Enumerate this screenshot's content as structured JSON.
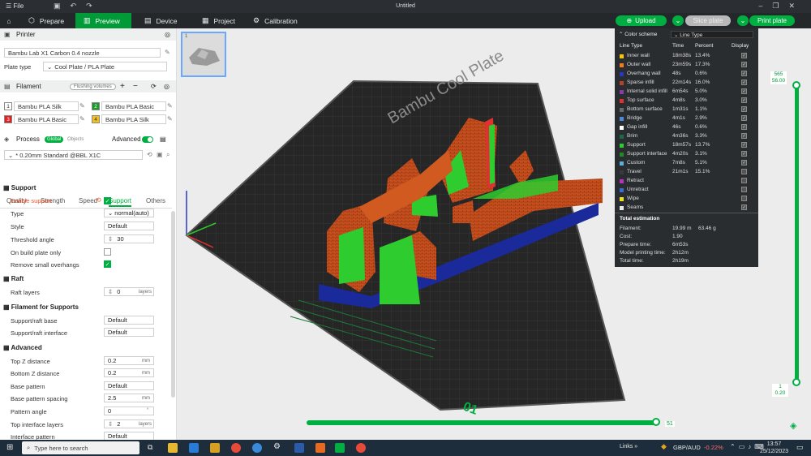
{
  "titlebar": {
    "file": "File",
    "title": "Untitled"
  },
  "nav": {
    "prepare": "Prepare",
    "preview": "Preview",
    "device": "Device",
    "project": "Project",
    "calibration": "Calibration",
    "upload": "Upload",
    "slice": "Slice plate",
    "print": "Print plate"
  },
  "printer": {
    "section": "Printer",
    "name": "Bambu Lab X1 Carbon 0.4 nozzle",
    "plate_label": "Plate type",
    "plate_value": "Cool Plate / PLA Plate"
  },
  "filament": {
    "section": "Filament",
    "flushing": "Flushing volumes",
    "items": [
      {
        "num": "1",
        "name": "Bambu PLA Silk",
        "color": "#ffffff"
      },
      {
        "num": "2",
        "name": "Bambu PLA Basic",
        "color": "#1a9a2a"
      },
      {
        "num": "3",
        "name": "Bambu PLA Basic",
        "color": "#e02020"
      },
      {
        "num": "4",
        "name": "Bambu PLA Silk",
        "color": "#f0c020"
      }
    ]
  },
  "process": {
    "section": "Process",
    "global": "Global",
    "objects": "Objects",
    "advanced": "Advanced",
    "preset": "* 0.20mm Standard @BBL X1C",
    "tabs": [
      "Quality",
      "Strength",
      "Speed",
      "Support",
      "Others"
    ]
  },
  "support": {
    "group": "Support",
    "enable": "Enable support",
    "type_label": "Type",
    "type_value": "normal(auto)",
    "style_label": "Style",
    "style_value": "Default",
    "threshold_label": "Threshold angle",
    "threshold_value": "30",
    "build_plate_label": "On build plate only",
    "remove_label": "Remove small overhangs"
  },
  "raft": {
    "group": "Raft",
    "layers_label": "Raft layers",
    "layers_value": "0",
    "layers_unit": "layers"
  },
  "filsup": {
    "group": "Filament for Supports",
    "base_label": "Support/raft base",
    "base_value": "Default",
    "iface_label": "Support/raft interface",
    "iface_value": "Default"
  },
  "advanced": {
    "group": "Advanced",
    "topz_label": "Top Z distance",
    "topz_value": "0.2",
    "botz_label": "Bottom Z distance",
    "botz_value": "0.2",
    "unit_mm": "mm",
    "pattern_label": "Base pattern",
    "pattern_value": "Default",
    "spacing_label": "Base pattern spacing",
    "spacing_value": "2.5",
    "angle_label": "Pattern angle",
    "angle_value": "0",
    "angle_unit": "°",
    "toplayers_label": "Top interface layers",
    "toplayers_value": "2",
    "toplayers_unit": "layers",
    "ifpattern_label": "Interface pattern",
    "ifpattern_value": "Default"
  },
  "legend": {
    "title": "Color scheme",
    "scheme": "Line Type",
    "col_type": "Line Type",
    "col_time": "Time",
    "col_percent": "Percent",
    "col_display": "Display",
    "rows": [
      {
        "name": "Inner wall",
        "time": "18m38s",
        "pct": "13.4%",
        "color": "#f3c800",
        "on": true
      },
      {
        "name": "Outer wall",
        "time": "23m59s",
        "pct": "17.3%",
        "color": "#f07a22",
        "on": true
      },
      {
        "name": "Overhang wall",
        "time": "48s",
        "pct": "0.6%",
        "color": "#2a36c8",
        "on": true
      },
      {
        "name": "Sparse infill",
        "time": "22m14s",
        "pct": "16.0%",
        "color": "#b5422a",
        "on": true
      },
      {
        "name": "Internal solid infill",
        "time": "6m54s",
        "pct": "5.0%",
        "color": "#8a3aa8",
        "on": true
      },
      {
        "name": "Top surface",
        "time": "4m8s",
        "pct": "3.0%",
        "color": "#e03030",
        "on": true
      },
      {
        "name": "Bottom surface",
        "time": "1m31s",
        "pct": "1.1%",
        "color": "#6a6a6a",
        "on": true
      },
      {
        "name": "Bridge",
        "time": "4m1s",
        "pct": "2.9%",
        "color": "#4a8ad8",
        "on": true
      },
      {
        "name": "Gap infill",
        "time": "46s",
        "pct": "0.6%",
        "color": "#ffffff",
        "on": true
      },
      {
        "name": "Brim",
        "time": "4m36s",
        "pct": "3.3%",
        "color": "#1a6a4a",
        "on": true
      },
      {
        "name": "Support",
        "time": "18m57s",
        "pct": "13.7%",
        "color": "#2ecc2e",
        "on": true
      },
      {
        "name": "Support interface",
        "time": "4m20s",
        "pct": "3.1%",
        "color": "#228a22",
        "on": true
      },
      {
        "name": "Custom",
        "time": "7m8s",
        "pct": "5.1%",
        "color": "#5ab0d8",
        "on": true
      },
      {
        "name": "Travel",
        "time": "21m1s",
        "pct": "15.1%",
        "color": "#3a3a3a",
        "on": false
      },
      {
        "name": "Retract",
        "time": "",
        "pct": "",
        "color": "#c030c0",
        "on": false
      },
      {
        "name": "Unretract",
        "time": "",
        "pct": "",
        "color": "#3a6ad8",
        "on": false
      },
      {
        "name": "Wipe",
        "time": "",
        "pct": "",
        "color": "#f0e020",
        "on": false
      },
      {
        "name": "Seams",
        "time": "",
        "pct": "",
        "color": "#e8e8e8",
        "on": true
      }
    ],
    "total_title": "Total estimation",
    "filament_label": "Filament:",
    "filament_len": "19.99 m",
    "filament_g": "63.46 g",
    "cost_label": "Cost:",
    "cost": "1.90",
    "prepare_label": "Prepare time:",
    "prepare": "6m53s",
    "model_label": "Model printing time:",
    "model": "2h12m",
    "total_label": "Total time:",
    "total": "2h19m"
  },
  "layers": {
    "top_num": "565",
    "top_height": "56.00",
    "bottom_num": "1",
    "bottom_height": "0.20",
    "move": "51"
  },
  "plate": {
    "brand": "Bambu Cool Plate",
    "number": "01"
  },
  "taskbar": {
    "search": "Type here to search",
    "links": "Links",
    "currency": "GBP/AUD",
    "change": "-0.22%",
    "time": "13:57",
    "date": "25/12/2023"
  }
}
